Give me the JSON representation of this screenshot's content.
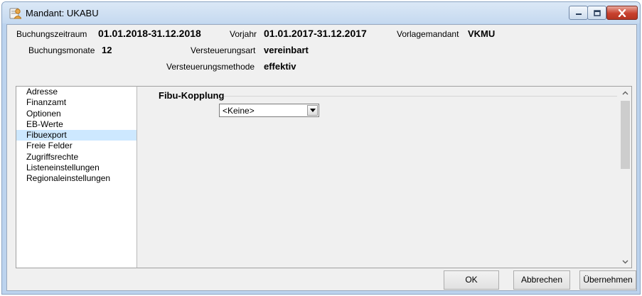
{
  "window": {
    "title": "Mandant: UKABU",
    "colors": {
      "title_bg": "#c5d9f0",
      "close_button": "#c8412e",
      "selection": "#cde8ff"
    }
  },
  "header": {
    "buchungszeitraum_label": "Buchungszeitraum",
    "buchungszeitraum_value": "01.01.2018-31.12.2018",
    "vorjahr_label": "Vorjahr",
    "vorjahr_value": "01.01.2017-31.12.2017",
    "vorlagemandant_label": "Vorlagemandant",
    "vorlagemandant_value": "VKMU",
    "buchungsmonate_label": "Buchungsmonate",
    "buchungsmonate_value": "12",
    "versteuerungsart_label": "Versteuerungsart",
    "versteuerungsart_value": "vereinbart",
    "versteuerungsmethode_label": "Versteuerungsmethode",
    "versteuerungsmethode_value": "effektiv"
  },
  "nav": {
    "selected": "Fibuexport",
    "items": [
      "Adresse",
      "Finanzamt",
      "Optionen",
      "EB-Werte",
      "Fibuexport",
      "Freie Felder",
      "Zugriffsrechte",
      "Listeneinstellungen",
      "Regionaleinstellungen"
    ]
  },
  "panel": {
    "section_title": "Fibu-Kopplung",
    "combo_value": "<Keine>"
  },
  "buttons": {
    "ok": "OK",
    "abbrechen": "Abbrechen",
    "uebernehmen": "Übernehmen"
  },
  "icons": {
    "app": "mandant-icon",
    "minimize": "minimize-icon",
    "maximize": "maximize-icon",
    "close": "close-icon"
  }
}
